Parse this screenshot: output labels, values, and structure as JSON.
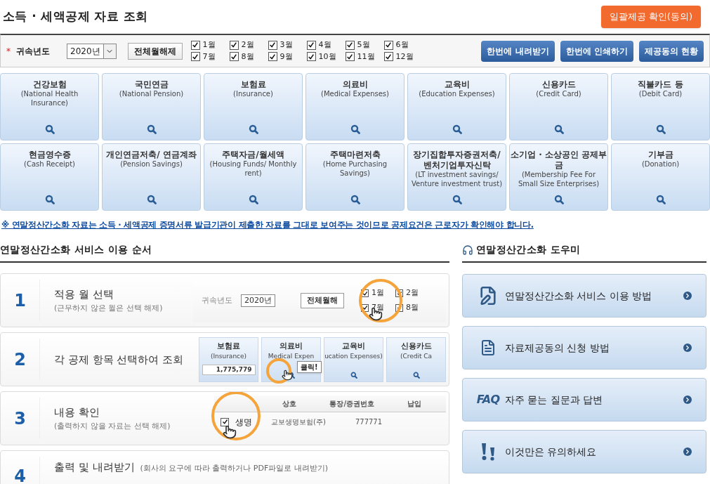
{
  "title": "소득 · 세액공제 자료 조회",
  "consent_button": "일괄제공 확인(동의)",
  "filter": {
    "label": "귀속년도",
    "required_mark": "*",
    "year": "2020년",
    "clear_button": "전체월해제",
    "months": [
      {
        "label": "1월",
        "checked": true
      },
      {
        "label": "2월",
        "checked": true
      },
      {
        "label": "3월",
        "checked": true
      },
      {
        "label": "4월",
        "checked": true
      },
      {
        "label": "5월",
        "checked": true
      },
      {
        "label": "6월",
        "checked": true
      },
      {
        "label": "7월",
        "checked": true
      },
      {
        "label": "8월",
        "checked": true
      },
      {
        "label": "9월",
        "checked": true
      },
      {
        "label": "10월",
        "checked": true
      },
      {
        "label": "11월",
        "checked": true
      },
      {
        "label": "12월",
        "checked": true
      }
    ],
    "actions": [
      "한번에 내려받기",
      "한번에 인쇄하기",
      "제공동의 현황"
    ]
  },
  "categories": [
    {
      "title": "건강보험",
      "subtitle": "(National Health Insurance)"
    },
    {
      "title": "국민연금",
      "subtitle": "(National Pension)"
    },
    {
      "title": "보험료",
      "subtitle": "(Insurance)"
    },
    {
      "title": "의료비",
      "subtitle": "(Medical Expenses)"
    },
    {
      "title": "교육비",
      "subtitle": "(Education Expenses)"
    },
    {
      "title": "신용카드",
      "subtitle": "(Credit Card)"
    },
    {
      "title": "직불카드 등",
      "subtitle": "(Debit Card)"
    },
    {
      "title": "현금영수증",
      "subtitle": "(Cash Receipt)"
    },
    {
      "title": "개인연금저축/ 연금계좌",
      "subtitle": "(Pension Savings)"
    },
    {
      "title": "주택자금/월세액",
      "subtitle": "(Housing Funds/ Monthly rent)"
    },
    {
      "title": "주택마련저축",
      "subtitle": "(Home Purchasing Savings)"
    },
    {
      "title": "장기집합투자증권저축/ 벤처기업투자신탁",
      "subtitle": "(LT investment savings/ Venture investment trust)"
    },
    {
      "title": "소기업 · 소상공인 공제부금",
      "subtitle": "(Membership Fee For Small Size Enterprises)"
    },
    {
      "title": "기부금",
      "subtitle": "(Donation)"
    }
  ],
  "notice": "※ 연말정산간소화 자료는 소득 · 세액공제 증명서류 발급기관이 제출한 자료를 그대로 보여주는 것이므로 공제요건은 근로자가 확인해야 합니다.",
  "steps_section": {
    "title": "연말정산간소화 서비스 이용 순서",
    "steps": [
      {
        "number": "1",
        "title": "적용 월 선택",
        "subtitle": "(근무하지 않은 월은 선택 해제)",
        "kind": "months",
        "sample": {
          "label": "귀속년도",
          "year": "2020년",
          "button": "전체월해",
          "months": [
            {
              "label": "1월",
              "checked": true
            },
            {
              "label": "7월",
              "checked": true
            },
            {
              "label": "2월",
              "checked": true
            },
            {
              "label": "8월",
              "checked": true
            }
          ]
        }
      },
      {
        "number": "2",
        "title": "각 공제 항목 선택하여 조회",
        "kind": "categories",
        "sample": {
          "tiles": [
            {
              "title": "보험료",
              "subtitle": "(Insurance)",
              "amount": "1,775,779"
            },
            {
              "title": "의료비",
              "subtitle": "Medical Expen"
            },
            {
              "title": "교육비",
              "subtitle": "ucation Expenses)"
            },
            {
              "title": "신용카드",
              "subtitle": "(Credit Ca"
            }
          ],
          "callout": "클릭!"
        }
      },
      {
        "number": "3",
        "title": "내용 확인",
        "subtitle": "(출력하지 않을 자료는 선택 해제)",
        "kind": "table",
        "sample": {
          "columns": [
            "상호",
            "통장/증권번호",
            "납입"
          ],
          "rows": [
            {
              "checked": true,
              "zoom_text": "생명",
              "cells": [
                "교보생명보험(주)",
                "777771"
              ]
            }
          ]
        }
      },
      {
        "number": "4",
        "title": "출력 및 내려받기",
        "note": "(회사의 요구에 따라 출력하거나 PDF파일로 내려받기)",
        "kind": "plain"
      }
    ]
  },
  "helper": {
    "title": "연말정산간소화 도우미",
    "items": [
      {
        "kind": "guide",
        "label": "연말정산간소화 서비스 이용 방법"
      },
      {
        "kind": "document",
        "label": "자료제공동의 신청 방법"
      },
      {
        "kind": "faq",
        "badge": "FAQ",
        "label": "자주 묻는 질문과 답변"
      },
      {
        "kind": "warning",
        "label": "이것만은 유의하세요"
      }
    ]
  }
}
